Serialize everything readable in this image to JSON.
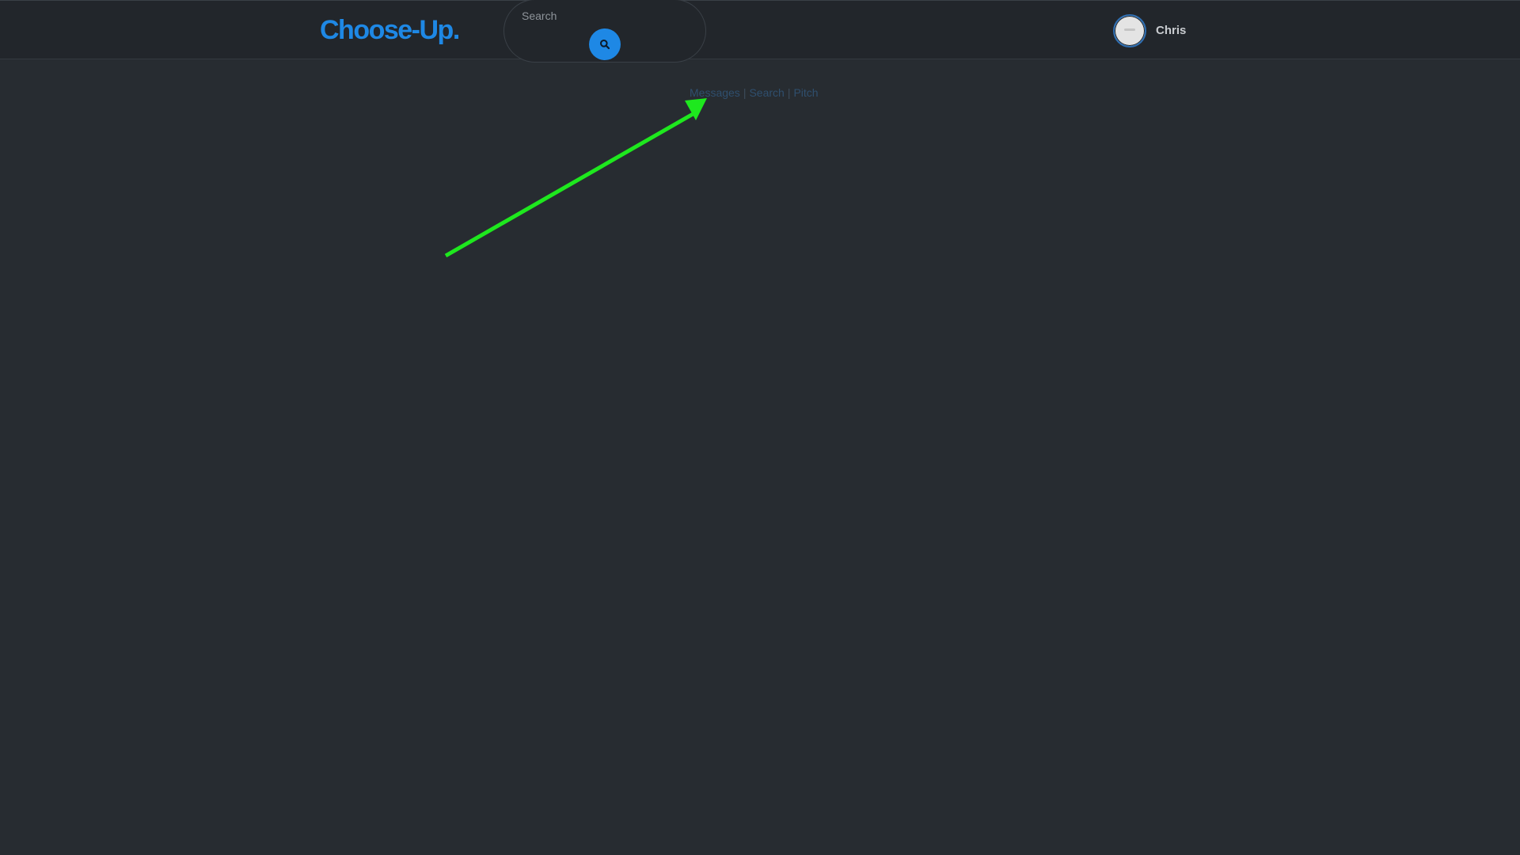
{
  "header": {
    "logo": "Choose-Up.",
    "search": {
      "placeholder": "Search",
      "button_icon": "search-icon"
    },
    "user": {
      "name": "Chris"
    }
  },
  "nav": {
    "links": [
      "Messages",
      "Search",
      "Pitch"
    ],
    "separator": "|"
  },
  "colors": {
    "brand": "#1e88e5",
    "background": "#272c31",
    "topbar": "#22262b",
    "annotation_arrow": "#1ee81e"
  }
}
